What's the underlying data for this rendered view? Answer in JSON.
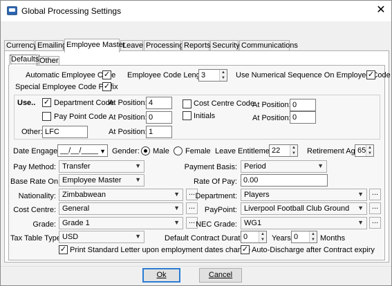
{
  "window": {
    "title": "Global Processing Settings",
    "close_glyph": "✕"
  },
  "tabs": [
    {
      "label": "Currency"
    },
    {
      "label": "Emailing"
    },
    {
      "label": "Employee Master",
      "active": true
    },
    {
      "label": "Leave"
    },
    {
      "label": "Processing"
    },
    {
      "label": "Reports"
    },
    {
      "label": "Security"
    },
    {
      "label": "Communications"
    }
  ],
  "subtabs": [
    {
      "label": "Defaults",
      "active": true
    },
    {
      "label": "Other"
    }
  ],
  "form": {
    "auto_code": {
      "label": "Automatic Employee Code",
      "checked": true
    },
    "code_length": {
      "label": "Employee Code Length:",
      "value": "3"
    },
    "numerical_seq": {
      "label": "Use Numerical Sequence On Employee Code",
      "checked": true
    },
    "special_prefix": {
      "label": "Special Employee Code Prefix",
      "checked": true
    },
    "use_label": "Use..",
    "dept_code": {
      "label": "Department Code",
      "checked": true,
      "position_label": "At Position:",
      "position": "4"
    },
    "pay_point_code": {
      "label": "Pay Point Code",
      "checked": false,
      "position_label": "At Position:",
      "position": "0"
    },
    "other": {
      "label": "Other:",
      "value": "LFC",
      "position_label": "At Position:",
      "position": "1"
    },
    "cost_centre_code": {
      "label": "Cost Centre Code",
      "checked": false,
      "position_label": "At Position:",
      "position": "0"
    },
    "initials": {
      "label": "Initials",
      "checked": false,
      "position_label": "At Position:",
      "position": "0"
    },
    "date_engaged": {
      "label": "Date Engaged:",
      "value": "__/__/____"
    },
    "gender": {
      "label": "Gender:",
      "male": "Male",
      "female": "Female",
      "selected": "Male"
    },
    "leave_entitlement": {
      "label": "Leave Entitlement:",
      "value": "22"
    },
    "retirement_age": {
      "label": "Retirement Age:",
      "value": "65"
    },
    "pay_method": {
      "label": "Pay Method:",
      "value": "Transfer"
    },
    "payment_basis": {
      "label": "Payment Basis:",
      "value": "Period"
    },
    "base_rate_on": {
      "label": "Base Rate On:",
      "value": "Employee Master"
    },
    "rate_of_pay": {
      "label": "Rate Of Pay:",
      "value": "0.00"
    },
    "nationality": {
      "label": "Nationality:",
      "value": "Zimbabwean",
      "lookup": "..."
    },
    "department": {
      "label": "Department:",
      "value": "Players",
      "lookup": "..."
    },
    "cost_centre": {
      "label": "Cost Centre:",
      "value": "General",
      "lookup": "..."
    },
    "paypoint": {
      "label": "PayPoint:",
      "value": "Liverpool Football Club Ground",
      "lookup": "..."
    },
    "grade": {
      "label": "Grade:",
      "value": "Grade 1",
      "lookup": "..."
    },
    "nec_grade": {
      "label": "NEC Grade:",
      "value": "WG1",
      "lookup": "..."
    },
    "tax_table_type": {
      "label": "Tax Table Type:",
      "value": "USD"
    },
    "contract_duration": {
      "label": "Default Contract Duration:",
      "years": "0",
      "years_label": "Years",
      "months": "0",
      "months_label": "Months"
    },
    "print_letter": {
      "label": "Print Standard Letter upon employment dates change",
      "checked": true
    },
    "auto_discharge": {
      "label": "Auto-Discharge after Contract expiry",
      "checked": true
    }
  },
  "buttons": {
    "ok": "Ok",
    "cancel": "Cancel"
  },
  "glyphs": {
    "check": "✓",
    "down": "▼",
    "up_small": "▲",
    "down_small": "▼"
  }
}
